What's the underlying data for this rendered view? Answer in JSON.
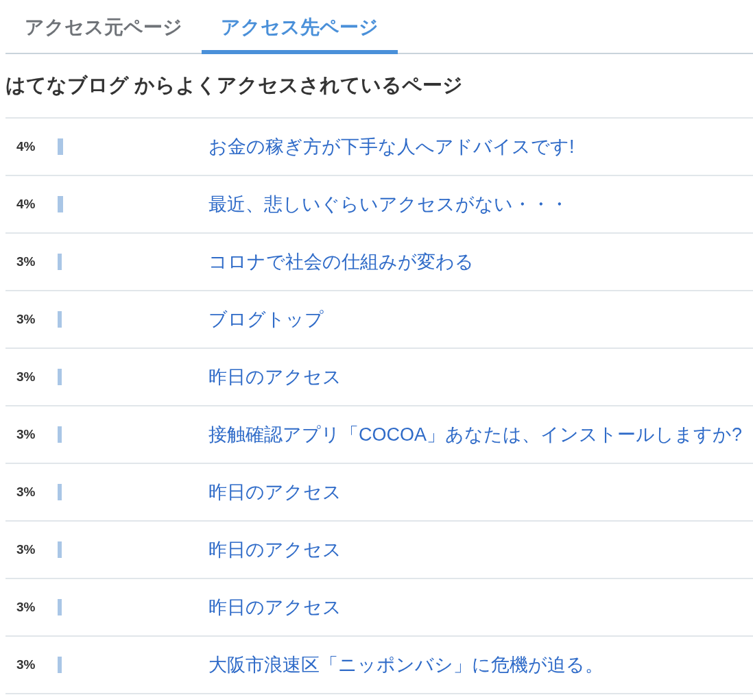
{
  "tabs": [
    {
      "label": "アクセス元ページ",
      "selected": false
    },
    {
      "label": "アクセス先ページ",
      "selected": true
    }
  ],
  "heading": "はてなブログ からよくアクセスされているページ",
  "rows": [
    {
      "percent": "4%",
      "level": 0.04,
      "title": "お金の稼ぎ方が下手な人へアドバイスです!"
    },
    {
      "percent": "4%",
      "level": 0.04,
      "title": "最近、悲しいぐらいアクセスがない・・・"
    },
    {
      "percent": "3%",
      "level": 0.03,
      "title": "コロナで社会の仕組みが変わる"
    },
    {
      "percent": "3%",
      "level": 0.03,
      "title": "ブログトップ"
    },
    {
      "percent": "3%",
      "level": 0.03,
      "title": "昨日のアクセス"
    },
    {
      "percent": "3%",
      "level": 0.03,
      "title": "接触確認アプリ「COCOA」あなたは、インストールしますか?"
    },
    {
      "percent": "3%",
      "level": 0.03,
      "title": "昨日のアクセス"
    },
    {
      "percent": "3%",
      "level": 0.03,
      "title": "昨日のアクセス"
    },
    {
      "percent": "3%",
      "level": 0.03,
      "title": "昨日のアクセス"
    },
    {
      "percent": "3%",
      "level": 0.03,
      "title": "大阪市浪速区「ニッポンバシ」に危機が迫る。"
    }
  ]
}
